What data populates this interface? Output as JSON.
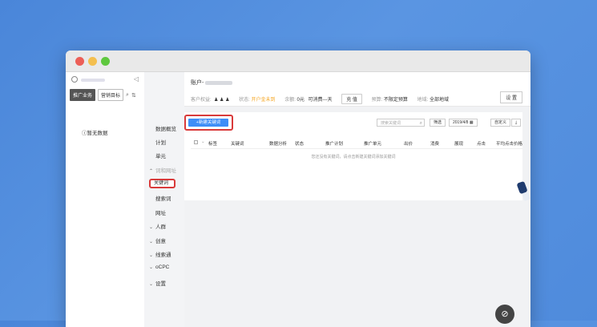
{
  "left_panel": {
    "tabs": [
      "推广业务",
      "营销目标"
    ],
    "empty_text": "暂无数据"
  },
  "nav": {
    "items": [
      "数据概览",
      "计划",
      "单元",
      "词和网址",
      "关键词",
      "搜索词",
      "网址",
      "人群",
      "创意",
      "线索通",
      "oCPC",
      "设置"
    ]
  },
  "account": {
    "title_prefix": "账户-",
    "row": {
      "customer_label": "客户权益:",
      "status_label": "状态:",
      "status_value": "开户金未到",
      "balance_label": "余额:",
      "balance_value": "0元",
      "days_value": "可消费---天",
      "recharge_button": "充 值",
      "budget_label": "预算:",
      "budget_value": "不限定预算",
      "region_label": "地域:",
      "region_value": "全部地域"
    },
    "settings_button": "设 置"
  },
  "toolbar": {
    "new_keyword_button": "+新建关键词",
    "search_placeholder": "搜索关键词",
    "filter_button": "筛选",
    "date_value": "2019/4/8",
    "customize_button": "自定义"
  },
  "table": {
    "columns": [
      "标签",
      "关键词",
      "数据分析",
      "状态",
      "推广计划",
      "推广单元",
      "出价",
      "消费",
      "展现",
      "点击",
      "平均点击价格"
    ],
    "empty_text": "您还没有关键词，请点击新建关键词添加关键词"
  },
  "colors": {
    "accent": "#3e8ef7",
    "highlight": "#d93a3a",
    "warning": "#f5a623",
    "background": "#4a86d9"
  }
}
